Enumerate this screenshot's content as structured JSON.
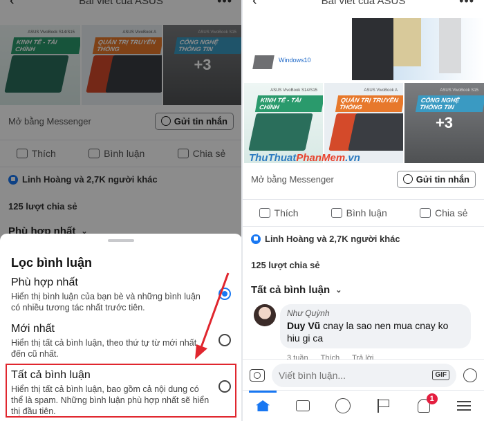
{
  "left": {
    "title": "Bài viết của ASUS",
    "open_with": "Mở bằng Messenger",
    "send_message": "Gửi tin nhắn",
    "actions": [
      "Thích",
      "Bình luận",
      "Chia sẻ"
    ],
    "likes": "Linh Hoàng và 2,7K người khác",
    "shares": "125 lượt chia sẻ",
    "current_filter": "Phù hợp nhất",
    "promo": {
      "brand1": "ASUS VivoBook S14/S15",
      "tag1": "KINH TẾ - TÀI CHÍNH",
      "brand2": "ASUS VivoBook A",
      "tag2": "QUẢN TRỊ TRUYỀN THÔNG",
      "brand3": "ASUS VivoBook S15",
      "tag3": "CÔNG NGHỆ THÔNG TIN",
      "more": "+3",
      "windows": "Windows10"
    },
    "sheet": {
      "title": "Lọc bình luận",
      "options": [
        {
          "title": "Phù hợp nhất",
          "desc": "Hiển thị bình luận của bạn bè và những bình luận có nhiều tương tác nhất trước tiên.",
          "selected": true
        },
        {
          "title": "Mới nhất",
          "desc": "Hiển thị tất cả bình luận, theo thứ tự từ mới nhất đến cũ nhất.",
          "selected": false
        },
        {
          "title": "Tất cả bình luận",
          "desc": "Hiển thị tất cả bình luận, bao gồm cả nội dung có thể là spam. Những bình luận phù hợp nhất sẽ hiển thị đầu tiên.",
          "selected": false
        }
      ]
    }
  },
  "right": {
    "title": "Bài viết của ASUS",
    "windows": "Windows10",
    "open_with": "Mở bằng Messenger",
    "send_message": "Gửi tin nhắn",
    "actions": [
      "Thích",
      "Bình luận",
      "Chia sẻ"
    ],
    "likes": "Linh Hoàng và 2,7K người khác",
    "shares": "125 lượt chia sẻ",
    "current_filter": "Tất cả bình luận",
    "comment": {
      "author": "Như Quỳnh",
      "mention": "Duy Vũ",
      "text": "cnay la sao nen mua cnay ko hiu gi ca",
      "time": "3 tuần",
      "like": "Thích",
      "reply": "Trả lời"
    },
    "composer_placeholder": "Viết bình luận...",
    "gif": "GIF",
    "notification_badge": "1"
  },
  "watermark": {
    "part1": "ThuThuat",
    "part2": "PhanMem",
    "part3": ".vn"
  },
  "colors": {
    "accent": "#1877f2",
    "highlight": "#e0262e"
  }
}
